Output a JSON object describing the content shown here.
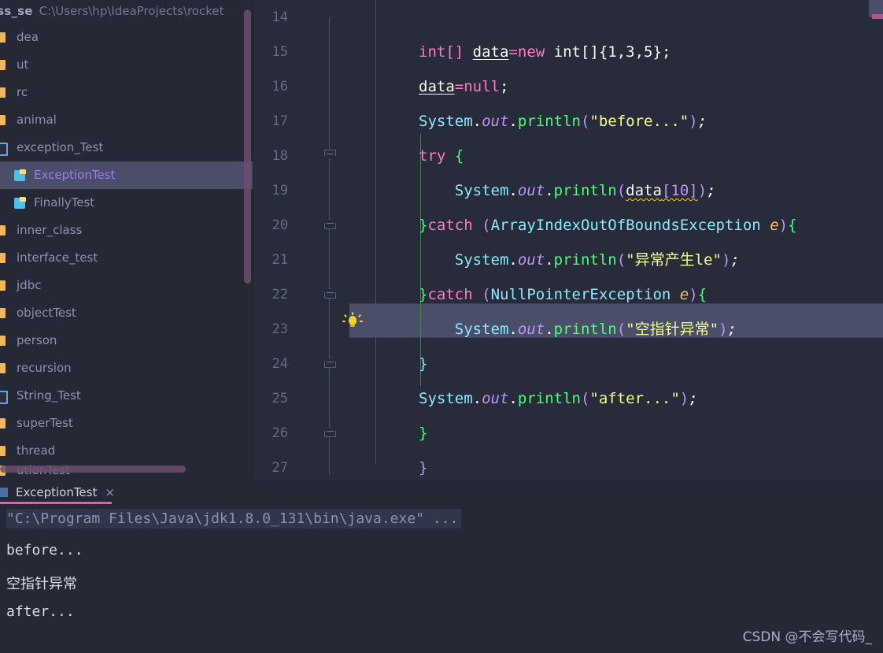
{
  "window": {
    "theme_bg": "#262935",
    "editor_bg": "#282b3a",
    "selection_bg": "#4a4e69",
    "accent_pink": "#ff4fb0"
  },
  "breadcrumb": {
    "project": "et_class_se",
    "path": "C:\\Users\\hp\\IdeaProjects\\rocket"
  },
  "sidebar": {
    "items": [
      {
        "label": "dea",
        "icon": "folder-icon",
        "indent": 0,
        "selected": false
      },
      {
        "label": "ut",
        "icon": "folder-icon",
        "indent": 0,
        "selected": false
      },
      {
        "label": "rc",
        "icon": "folder-icon",
        "indent": 0,
        "selected": false
      },
      {
        "label": "animal",
        "icon": "folder-icon",
        "indent": 0,
        "selected": false
      },
      {
        "label": "exception_Test",
        "icon": "module-icon",
        "indent": 0,
        "selected": false
      },
      {
        "label": "ExceptionTest",
        "icon": "java-class-icon",
        "indent": 1,
        "selected": true
      },
      {
        "label": "FinallyTest",
        "icon": "java-class-icon",
        "indent": 1,
        "selected": false
      },
      {
        "label": "inner_class",
        "icon": "folder-icon",
        "indent": 0,
        "selected": false
      },
      {
        "label": "interface_test",
        "icon": "folder-icon",
        "indent": 0,
        "selected": false
      },
      {
        "label": "jdbc",
        "icon": "folder-icon",
        "indent": 0,
        "selected": false
      },
      {
        "label": "objectTest",
        "icon": "folder-icon",
        "indent": 0,
        "selected": false
      },
      {
        "label": "person",
        "icon": "folder-icon",
        "indent": 0,
        "selected": false
      },
      {
        "label": "recursion",
        "icon": "folder-icon",
        "indent": 0,
        "selected": false
      },
      {
        "label": "String_Test",
        "icon": "module-icon",
        "indent": 0,
        "selected": false
      },
      {
        "label": "superTest",
        "icon": "folder-icon",
        "indent": 0,
        "selected": false
      },
      {
        "label": "thread",
        "icon": "folder-icon",
        "indent": 0,
        "selected": false
      }
    ],
    "cutoff_item": "utionTest"
  },
  "editor": {
    "highlighted_line": 23,
    "quickfix_icon": "lightbulb-icon",
    "lines": [
      {
        "n": 14,
        "fold": null,
        "tokens": []
      },
      {
        "n": 15,
        "fold": null,
        "tokens": [
          {
            "t": "int[]",
            "c": "kw"
          },
          {
            "t": " ",
            "c": "ident"
          },
          {
            "t": "data",
            "c": "ident under"
          },
          {
            "t": "=",
            "c": "kw"
          },
          {
            "t": "new",
            "c": "kw"
          },
          {
            "t": " ",
            "c": "ident"
          },
          {
            "t": "int[]{",
            "c": "ident"
          },
          {
            "t": "1,3,5",
            "c": "num"
          },
          {
            "t": "};",
            "c": "ident"
          }
        ]
      },
      {
        "n": 16,
        "fold": null,
        "tokens": [
          {
            "t": "data",
            "c": "ident under"
          },
          {
            "t": "=",
            "c": "kw"
          },
          {
            "t": "null",
            "c": "kw"
          },
          {
            "t": ";",
            "c": "ident"
          }
        ]
      },
      {
        "n": 17,
        "fold": null,
        "tokens": [
          {
            "t": "System",
            "c": "type"
          },
          {
            "t": ".",
            "c": "ident"
          },
          {
            "t": "out",
            "c": "field"
          },
          {
            "t": ".",
            "c": "ident"
          },
          {
            "t": "println",
            "c": "fn"
          },
          {
            "t": "(",
            "c": "punct"
          },
          {
            "t": "\"before...\"",
            "c": "str"
          },
          {
            "t": ")",
            "c": "punct"
          },
          {
            "t": ";",
            "c": "semi"
          }
        ]
      },
      {
        "n": 18,
        "fold": "down",
        "tokens": [
          {
            "t": "try",
            "c": "kw"
          },
          {
            "t": " ",
            "c": "ident"
          },
          {
            "t": "{",
            "c": "brace"
          }
        ]
      },
      {
        "n": 19,
        "fold": null,
        "tokens": [
          {
            "t": "    ",
            "c": "ident"
          },
          {
            "t": "System",
            "c": "type"
          },
          {
            "t": ".",
            "c": "ident"
          },
          {
            "t": "out",
            "c": "field"
          },
          {
            "t": ".",
            "c": "ident"
          },
          {
            "t": "println",
            "c": "fn"
          },
          {
            "t": "(",
            "c": "punct"
          },
          {
            "t": "data",
            "c": "ident wavy"
          },
          {
            "t": "[10]",
            "c": "punct wavy"
          },
          {
            "t": ")",
            "c": "punct"
          },
          {
            "t": ";",
            "c": "semi"
          }
        ]
      },
      {
        "n": 20,
        "fold": "up",
        "tokens": [
          {
            "t": "}",
            "c": "brace"
          },
          {
            "t": "catch",
            "c": "kw"
          },
          {
            "t": " ",
            "c": "ident"
          },
          {
            "t": "(",
            "c": "punct"
          },
          {
            "t": "ArrayIndexOutOfBoundsException",
            "c": "cls"
          },
          {
            "t": " ",
            "c": "ident"
          },
          {
            "t": "e",
            "c": "param"
          },
          {
            "t": ")",
            "c": "punct"
          },
          {
            "t": "{",
            "c": "brace"
          }
        ]
      },
      {
        "n": 21,
        "fold": null,
        "tokens": [
          {
            "t": "    ",
            "c": "ident"
          },
          {
            "t": "System",
            "c": "type"
          },
          {
            "t": ".",
            "c": "ident"
          },
          {
            "t": "out",
            "c": "field"
          },
          {
            "t": ".",
            "c": "ident"
          },
          {
            "t": "println",
            "c": "fn"
          },
          {
            "t": "(",
            "c": "punct"
          },
          {
            "t": "\"异常产生le\"",
            "c": "str"
          },
          {
            "t": ")",
            "c": "punct"
          },
          {
            "t": ";",
            "c": "semi"
          }
        ]
      },
      {
        "n": 22,
        "fold": "up",
        "tokens": [
          {
            "t": "}",
            "c": "brace"
          },
          {
            "t": "catch",
            "c": "kw"
          },
          {
            "t": " ",
            "c": "ident"
          },
          {
            "t": "(",
            "c": "punct"
          },
          {
            "t": "NullPointerException",
            "c": "cls"
          },
          {
            "t": " ",
            "c": "ident"
          },
          {
            "t": "e",
            "c": "param"
          },
          {
            "t": ")",
            "c": "punct"
          },
          {
            "t": "{",
            "c": "brace"
          }
        ]
      },
      {
        "n": 23,
        "fold": null,
        "tokens": [
          {
            "t": "    ",
            "c": "ident"
          },
          {
            "t": "System",
            "c": "type"
          },
          {
            "t": ".",
            "c": "ident"
          },
          {
            "t": "out",
            "c": "field"
          },
          {
            "t": ".",
            "c": "ident"
          },
          {
            "t": "println",
            "c": "fn"
          },
          {
            "t": "(",
            "c": "punct"
          },
          {
            "t": "\"空指针异常\"",
            "c": "str"
          },
          {
            "t": ")",
            "c": "punct"
          },
          {
            "t": ";",
            "c": "semi"
          }
        ]
      },
      {
        "n": 24,
        "fold": "up",
        "tokens": [
          {
            "t": "}",
            "c": "type"
          }
        ]
      },
      {
        "n": 25,
        "fold": null,
        "tokens": [
          {
            "t": "System",
            "c": "type"
          },
          {
            "t": ".",
            "c": "ident"
          },
          {
            "t": "out",
            "c": "field"
          },
          {
            "t": ".",
            "c": "ident"
          },
          {
            "t": "println",
            "c": "fn"
          },
          {
            "t": "(",
            "c": "punct"
          },
          {
            "t": "\"after...\"",
            "c": "str"
          },
          {
            "t": ")",
            "c": "punct"
          },
          {
            "t": ";",
            "c": "semi"
          }
        ]
      },
      {
        "n": 26,
        "fold": "up",
        "tokens": [
          {
            "t": "}",
            "c": "brace"
          }
        ]
      },
      {
        "n": 27,
        "fold": null,
        "tokens": [
          {
            "t": "}",
            "c": "punct"
          }
        ]
      }
    ]
  },
  "console": {
    "tab_label": "ExceptionTest",
    "tab_close": "×",
    "command": "\"C:\\Program Files\\Java\\jdk1.8.0_131\\bin\\java.exe\" ...",
    "output": [
      "before...",
      "空指针异常",
      "after..."
    ]
  },
  "watermark": "CSDN @不会写代码_"
}
